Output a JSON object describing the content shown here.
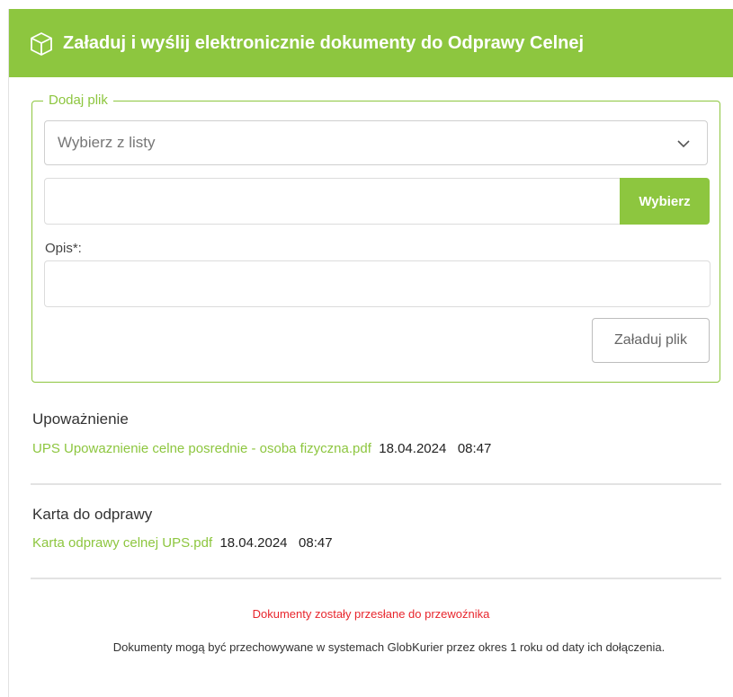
{
  "header": {
    "title": "Załaduj i wyślij elektronicznie dokumenty do Odprawy Celnej",
    "icon": "box-icon",
    "color": "#8dc63f"
  },
  "upload": {
    "legend": "Dodaj plik",
    "select_value": "Wybierz z listy",
    "file_value": "",
    "browse_label": "Wybierz",
    "opis_label": "Opis*:",
    "opis_value": "",
    "upload_button_label": "Załaduj plik"
  },
  "sections": [
    {
      "title": "Upoważnienie",
      "file_name": "UPS Upowaznienie celne posrednie - osoba fizyczna.pdf",
      "date": "18.04.2024",
      "time": "08:47"
    },
    {
      "title": "Karta do odprawy",
      "file_name": "Karta odprawy celnej UPS.pdf",
      "date": "18.04.2024",
      "time": "08:47"
    }
  ],
  "status_message": "Dokumenty zostały przesłane do przewoźnika",
  "retention_note": "Dokumenty mogą być przechowywane w systemach GlobKurier przez okres 1 roku od daty ich dołączenia.",
  "colors": {
    "accent": "#8dc63f",
    "status": "#e8262d"
  }
}
